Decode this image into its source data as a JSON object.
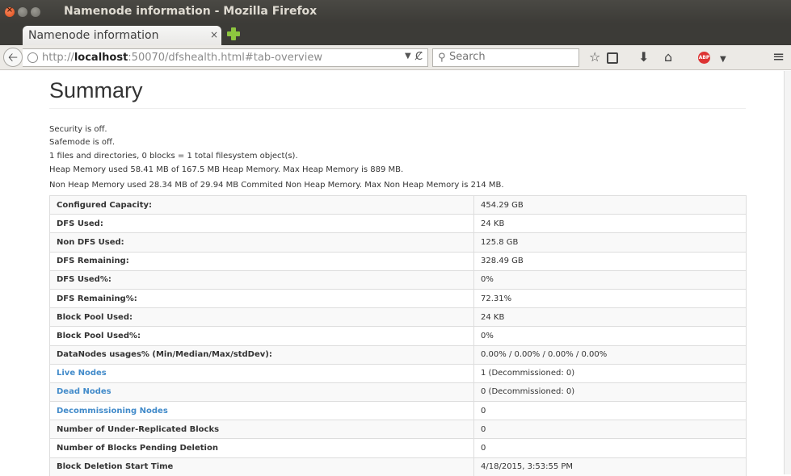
{
  "window": {
    "title": "Namenode information - Mozilla Firefox"
  },
  "tab": {
    "label": "Namenode information",
    "close": "×"
  },
  "navbar": {
    "url_prefix": "http://",
    "url_host": "localhost",
    "url_rest": ":50070/dfshealth.html#tab-overview",
    "search_placeholder": "Search"
  },
  "icons": {
    "back": "back-arrow-icon",
    "globe": "globe-icon",
    "reload": "reload-icon",
    "search": "search-icon",
    "star": "star-icon",
    "reading": "reading-list-icon",
    "download": "download-icon",
    "home": "home-icon",
    "adblock": "adblock-icon",
    "menu": "menu-icon"
  },
  "colors": {
    "link": "#428bca",
    "titlebar": "#3c3b37",
    "text": "#333333"
  },
  "page": {
    "title": "Summary",
    "info_lines": [
      "Security is off.",
      "Safemode is off.",
      "1 files and directories, 0 blocks = 1 total filesystem object(s).",
      "Heap Memory used 58.41 MB of 167.5 MB Heap Memory. Max Heap Memory is 889 MB.",
      "Non Heap Memory used 28.34 MB of 29.94 MB Commited Non Heap Memory. Max Non Heap Memory is 214 MB."
    ],
    "rows": [
      {
        "label": "Configured Capacity:",
        "value": "454.29 GB"
      },
      {
        "label": "DFS Used:",
        "value": "24 KB"
      },
      {
        "label": "Non DFS Used:",
        "value": "125.8 GB"
      },
      {
        "label": "DFS Remaining:",
        "value": "328.49 GB"
      },
      {
        "label": "DFS Used%:",
        "value": "0%"
      },
      {
        "label": "DFS Remaining%:",
        "value": "72.31%"
      },
      {
        "label": "Block Pool Used:",
        "value": "24 KB"
      },
      {
        "label": "Block Pool Used%:",
        "value": "0%"
      },
      {
        "label": "DataNodes usages% (Min/Median/Max/stdDev):",
        "value": "0.00% / 0.00% / 0.00% / 0.00%"
      },
      {
        "label": "Live Nodes",
        "value": "1 (Decommissioned: 0)"
      },
      {
        "label": "Dead Nodes",
        "value": "0 (Decommissioned: 0)"
      },
      {
        "label": "Decommissioning Nodes",
        "value": "0"
      },
      {
        "label": "Number of Under-Replicated Blocks",
        "value": "0"
      },
      {
        "label": "Number of Blocks Pending Deletion",
        "value": "0"
      },
      {
        "label": "Block Deletion Start Time",
        "value": "4/18/2015, 3:53:55 PM"
      }
    ]
  }
}
